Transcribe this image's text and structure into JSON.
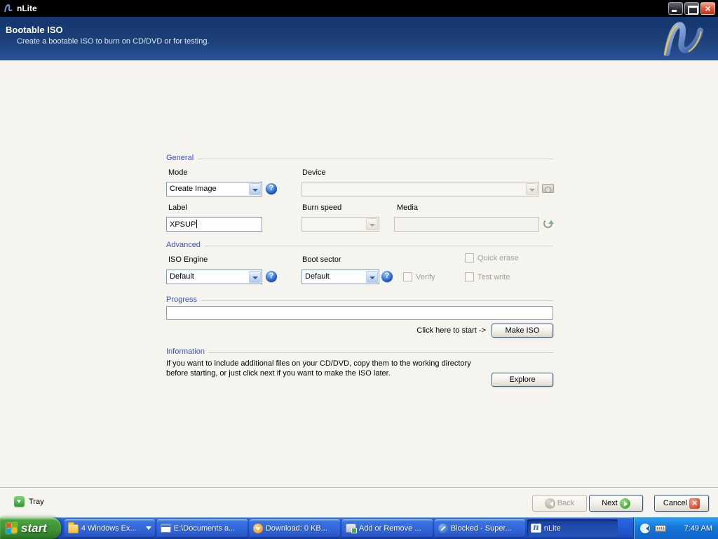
{
  "window": {
    "title": "nLite"
  },
  "header": {
    "title": "Bootable ISO",
    "subtitle": "Create a bootable ISO to burn on CD/DVD or for testing."
  },
  "form": {
    "general": {
      "section_label": "General",
      "mode_label": "Mode",
      "mode_value": "Create Image",
      "device_label": "Device",
      "device_value": "",
      "label_label": "Label",
      "label_value": "XPSUP",
      "burn_speed_label": "Burn speed",
      "burn_speed_value": "",
      "media_label": "Media",
      "media_value": ""
    },
    "advanced": {
      "section_label": "Advanced",
      "iso_engine_label": "ISO Engine",
      "iso_engine_value": "Default",
      "boot_sector_label": "Boot sector",
      "boot_sector_value": "Default",
      "verify_label": "Verify",
      "quick_erase_label": "Quick erase",
      "test_write_label": "Test write"
    },
    "progress": {
      "section_label": "Progress",
      "percent": 0,
      "start_hint": "Click here to start ->",
      "make_iso_button": "Make ISO"
    },
    "information": {
      "section_label": "Information",
      "text": "If you want to include additional files on your CD/DVD, copy them to the working directory before starting, or just click next if you want to make the ISO later.",
      "explore_button": "Explore"
    }
  },
  "footer": {
    "tray_button": "Tray",
    "back_button": "Back",
    "next_button": "Next",
    "cancel_button": "Cancel"
  },
  "taskbar": {
    "start_button": "start",
    "items": [
      {
        "label": "4 Windows Ex...",
        "icon": "folder-icon",
        "active": false
      },
      {
        "label": "E:\\Documents a...",
        "icon": "explorer-icon",
        "active": false
      },
      {
        "label": "Download: 0 KB...",
        "icon": "download-icon",
        "active": false
      },
      {
        "label": "Add or Remove ...",
        "icon": "add-remove-icon",
        "active": false
      },
      {
        "label": "Blocked - Super...",
        "icon": "blocked-icon",
        "active": false
      },
      {
        "label": "nLite",
        "icon": "nlite-icon",
        "active": true
      }
    ],
    "tray": {
      "clock": "7:49 AM"
    }
  },
  "colors": {
    "header_blue": "#1c4078",
    "section_label_blue": "#3850c8",
    "taskbar_blue": "#2459d4",
    "start_green": "#3d9334",
    "close_red": "#cb3414"
  }
}
